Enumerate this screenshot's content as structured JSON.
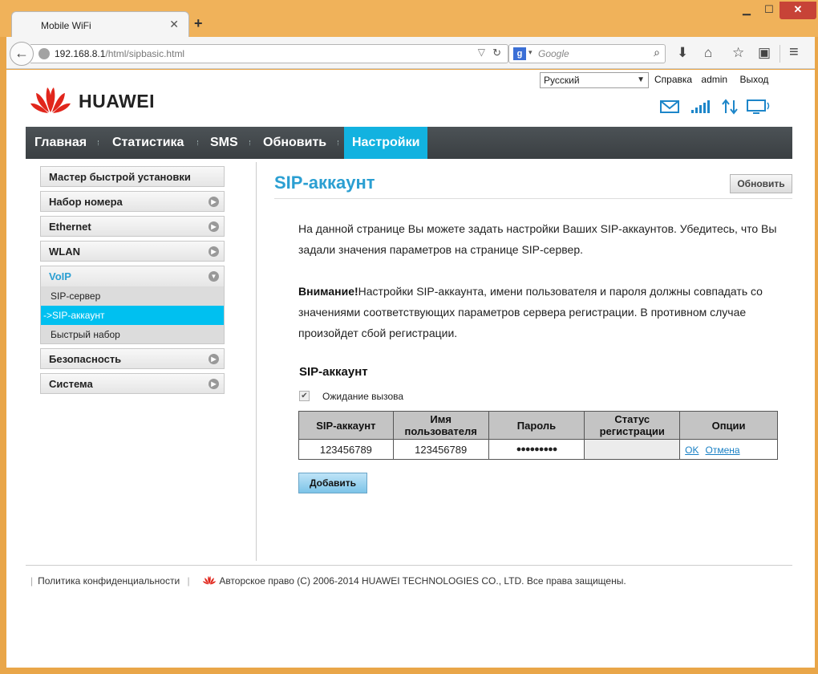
{
  "browser": {
    "tab_title": "Mobile WiFi",
    "url_host": "192.168.8.1",
    "url_path": "/html/sipbasic.html",
    "search_placeholder": "Google",
    "search_engine_icon": "google-g-icon",
    "window_buttons": [
      "minimize",
      "maximize",
      "close"
    ]
  },
  "header": {
    "language": "Русский",
    "links": [
      "Справка",
      "admin",
      "Выход"
    ],
    "logo_text": "HUAWEI",
    "status_icons": [
      "mail-icon",
      "signal-icon",
      "transfer-icon",
      "monitor-icon"
    ],
    "accent_color": "#12b2e0",
    "brand_color": "#e1261c"
  },
  "menu": {
    "items": [
      "Главная",
      "Статистика",
      "SMS",
      "Обновить",
      "Настройки"
    ],
    "active": "Настройки"
  },
  "sidebar": {
    "items": [
      "Мастер быстрой установки",
      "Набор номера",
      "Ethernet",
      "WLAN",
      "VoIP",
      "Безопасность",
      "Система"
    ],
    "voip_sub": [
      "SIP-сервер",
      "->SIP-аккаунт",
      "Быстрый набор"
    ]
  },
  "content": {
    "title": "SIP-аккаунт",
    "refresh_label": "Обновить",
    "intro": "На данной странице Вы можете задать настройки Ваших SIP-аккаунтов. Убедитесь, что Вы задали значения параметров на странице SIP-сервер.",
    "warning_bold": "Внимание!",
    "warning_text": "Настройки SIP-аккаунта, имени пользователя и пароля должны совпадать со значениями соответствующих параметров сервера регистрации. В противном случае произойдет сбой регистрации.",
    "section_title": "SIP-аккаунт",
    "call_waiting_label": "Ожидание вызова",
    "call_waiting_checked": true,
    "table": {
      "headers": [
        "SIP-аккаунт",
        "Имя пользователя",
        "Пароль",
        "Статус регистрации",
        "Опции"
      ],
      "row": {
        "account": "123456789",
        "username": "123456789",
        "password": "●●●●●●●●●",
        "status": "",
        "ok": "OK",
        "cancel": "Отмена"
      }
    },
    "add_label": "Добавить"
  },
  "footer": {
    "privacy": "Политика конфиденциальности",
    "copyright": "Авторское право (C) 2006-2014 HUAWEI TECHNOLOGIES CO., LTD. Все права защищены."
  }
}
